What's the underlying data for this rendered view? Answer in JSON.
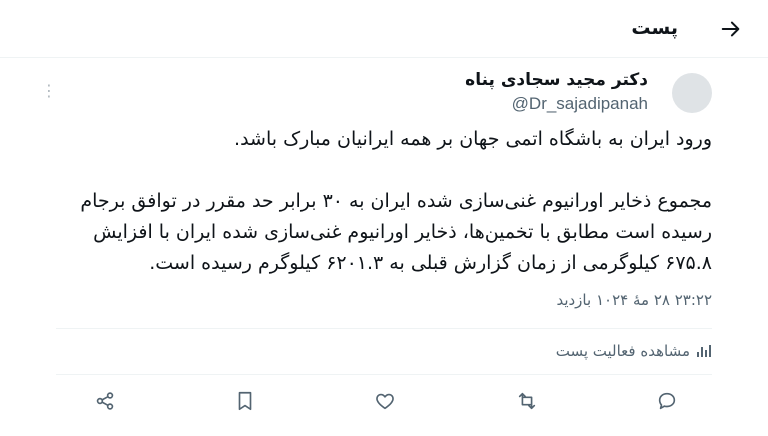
{
  "header": {
    "title": "پست",
    "back_icon": "arrow-right-icon"
  },
  "author": {
    "name": "دکتر مجید سجادی پناه",
    "handle": "@Dr_sajadipanah"
  },
  "more_icon": "more-vertical-icon",
  "post": {
    "paragraphs": [
      "ورود ایران به باشگاه اتمی جهان بر همه ایرانیان مبارک باشد.",
      "مجموع ذخایر اورانیوم غنی‌سازی شده ایران به ۳۰ برابر حد مقرر در توافق برجام رسیده است مطابق با تخمین‌ها، ذخایر اورانیوم غنی‌سازی شده ایران با افزایش ۶۷۵.۸ کیلوگرمی از زمان گزارش قبلی به ۶۲۰۱.۳ کیلوگرم رسیده است."
    ],
    "timestamp": "۲۳:۲۲ ۲۸ مهٔ ۱۰۲۴ بازدید"
  },
  "activity": {
    "label": "مشاهده فعالیت پست",
    "icon": "bar-chart-icon"
  },
  "actions": {
    "reply_icon": "reply-icon",
    "repost_icon": "repost-icon",
    "like_icon": "heart-icon",
    "bookmark_icon": "bookmark-icon",
    "share_icon": "share-icon"
  },
  "colors": {
    "text": "#0f1419",
    "secondary": "#536471",
    "border": "#eff3f4"
  }
}
